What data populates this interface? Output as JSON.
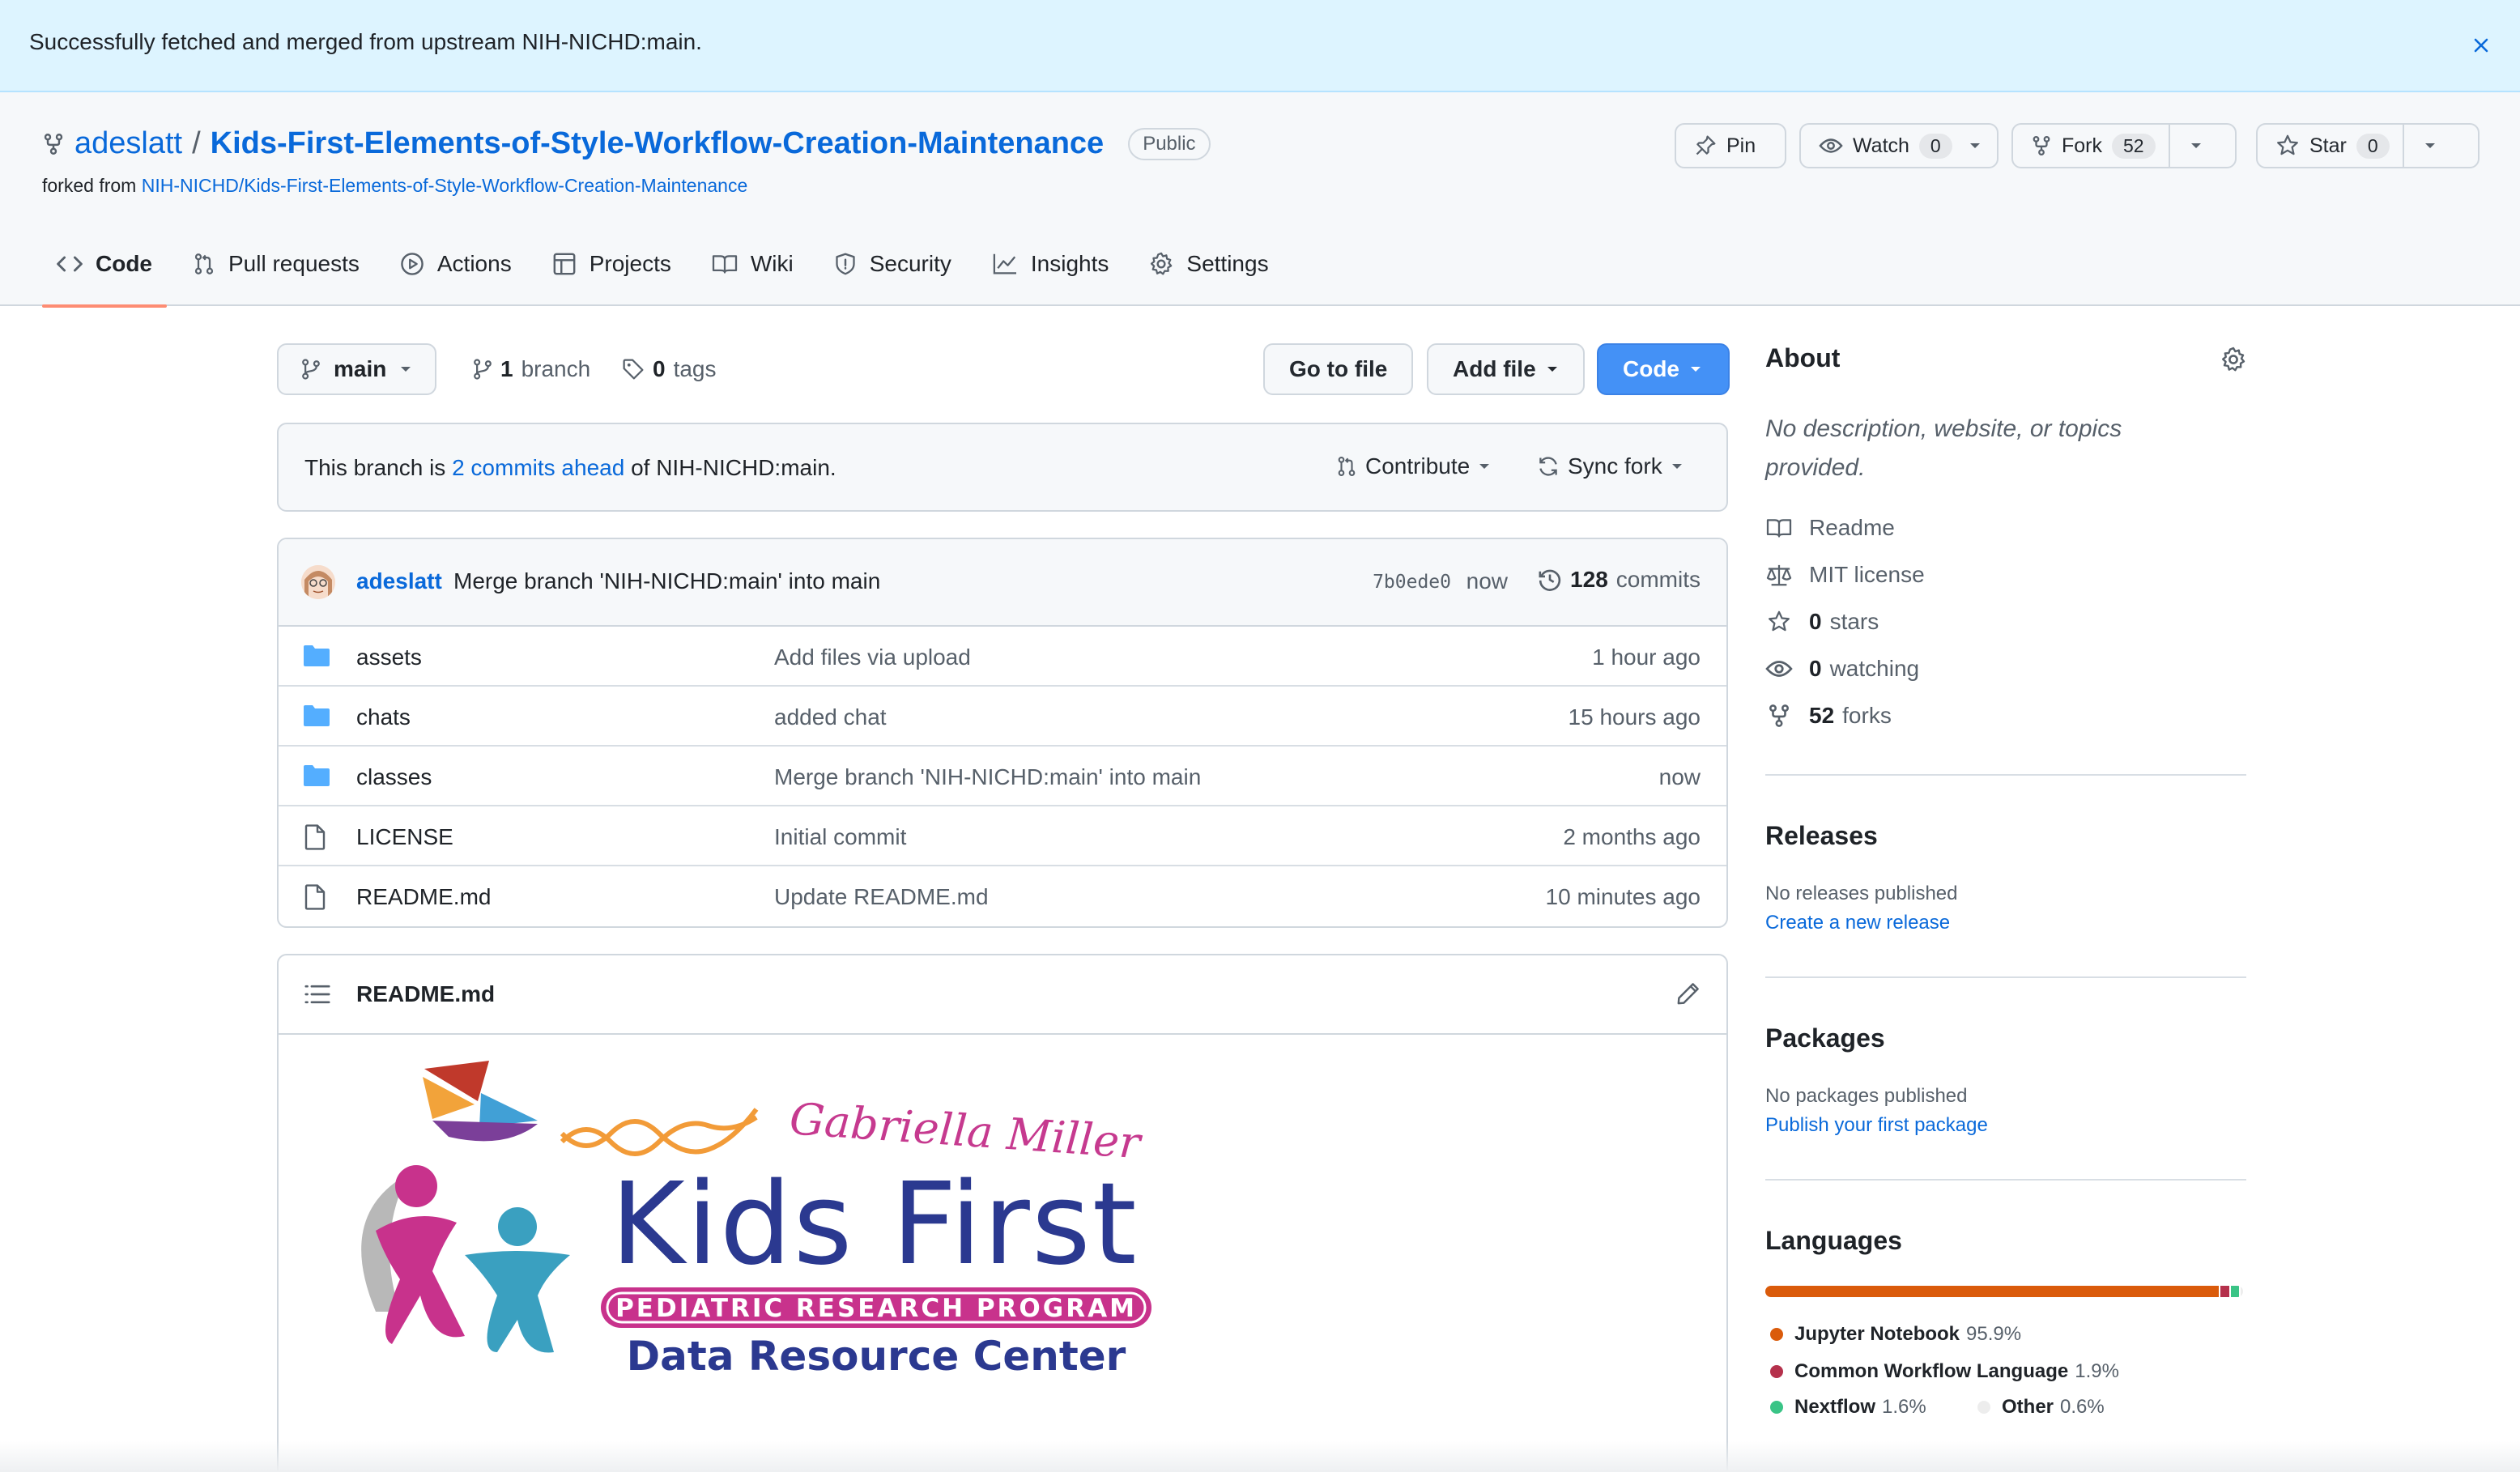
{
  "flash": {
    "message": "Successfully fetched and merged from upstream NIH-NICHD:main."
  },
  "repo": {
    "owner": "adeslatt",
    "separator": "/",
    "name": "Kids-First-Elements-of-Style-Workflow-Creation-Maintenance",
    "visibility": "Public",
    "forked_prefix": "forked from",
    "forked_from": "NIH-NICHD/Kids-First-Elements-of-Style-Workflow-Creation-Maintenance"
  },
  "actions": {
    "pin": "Pin",
    "watch": "Watch",
    "watch_count": "0",
    "fork": "Fork",
    "fork_count": "52",
    "star": "Star",
    "star_count": "0"
  },
  "tabs": [
    {
      "label": "Code",
      "icon": "code-icon"
    },
    {
      "label": "Pull requests",
      "icon": "pull-request-icon"
    },
    {
      "label": "Actions",
      "icon": "play-icon"
    },
    {
      "label": "Projects",
      "icon": "table-icon"
    },
    {
      "label": "Wiki",
      "icon": "book-icon"
    },
    {
      "label": "Security",
      "icon": "shield-icon"
    },
    {
      "label": "Insights",
      "icon": "graph-icon"
    },
    {
      "label": "Settings",
      "icon": "gear-icon"
    }
  ],
  "toolbar": {
    "branch": "main",
    "branch_count": "1",
    "branch_label": "branch",
    "tag_count": "0",
    "tag_label": "tags",
    "go_to_file": "Go to file",
    "add_file": "Add file",
    "code": "Code"
  },
  "ahead": {
    "prefix": "This branch is",
    "link": "2 commits ahead",
    "suffix": "of NIH-NICHD:main.",
    "contribute": "Contribute",
    "sync": "Sync fork"
  },
  "latest_commit": {
    "author": "adeslatt",
    "message": "Merge branch 'NIH-NICHD:main' into main",
    "sha": "7b0ede0",
    "time": "now",
    "count": "128",
    "count_label": "commits"
  },
  "files": [
    {
      "type": "folder",
      "name": "assets",
      "message": "Add files via upload",
      "age": "1 hour ago"
    },
    {
      "type": "folder",
      "name": "chats",
      "message": "added chat",
      "age": "15 hours ago"
    },
    {
      "type": "folder",
      "name": "classes",
      "message": "Merge branch 'NIH-NICHD:main' into main",
      "age": "now"
    },
    {
      "type": "file",
      "name": "LICENSE",
      "message": "Initial commit",
      "age": "2 months ago"
    },
    {
      "type": "file",
      "name": "README.md",
      "message": "Update README.md",
      "age": "10 minutes ago"
    }
  ],
  "readme": {
    "title": "README.md",
    "logo": {
      "script": "Gabriella Miller",
      "main": "Kids First",
      "banner": "PEDIATRIC RESEARCH PROGRAM",
      "sub": "Data Resource Center"
    }
  },
  "about": {
    "title": "About",
    "description": "No description, website, or topics provided.",
    "items": [
      {
        "icon": "book-icon",
        "bold": "",
        "label": "Readme"
      },
      {
        "icon": "law-icon",
        "bold": "",
        "label": "MIT license"
      },
      {
        "icon": "star-icon",
        "bold": "0",
        "label": "stars"
      },
      {
        "icon": "eye-icon",
        "bold": "0",
        "label": "watching"
      },
      {
        "icon": "fork-icon",
        "bold": "52",
        "label": "forks"
      }
    ]
  },
  "releases": {
    "title": "Releases",
    "empty": "No releases published",
    "link": "Create a new release"
  },
  "packages": {
    "title": "Packages",
    "empty": "No packages published",
    "link": "Publish your first package"
  },
  "languages": {
    "title": "Languages",
    "list": [
      {
        "name": "Jupyter Notebook",
        "percent": "95.9%",
        "value": 95.9,
        "color": "#DA5B0B"
      },
      {
        "name": "Common Workflow Language",
        "percent": "1.9%",
        "value": 1.9,
        "color": "#B5314C"
      },
      {
        "name": "Nextflow",
        "percent": "1.6%",
        "value": 1.6,
        "color": "#3AC486"
      },
      {
        "name": "Other",
        "percent": "0.6%",
        "value": 0.6,
        "color": "#EDEDED"
      }
    ]
  }
}
